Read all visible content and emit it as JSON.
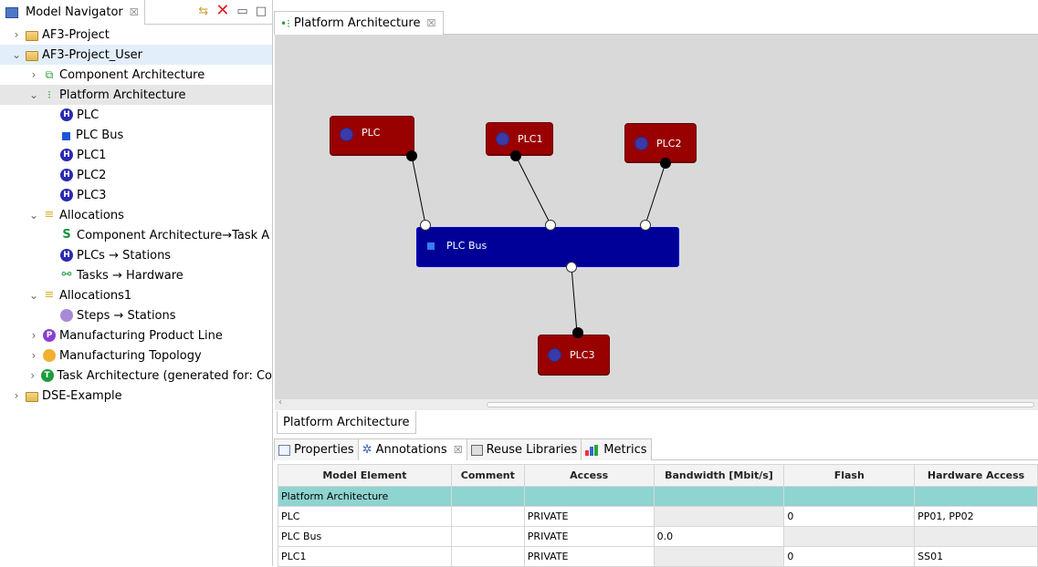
{
  "navigator": {
    "title": "Model Navigator",
    "close": "☒",
    "tree": [
      {
        "label": "AF3-Project",
        "level": 0,
        "twisty": "›",
        "icon": "folder"
      },
      {
        "label": "AF3-Project_User",
        "level": 0,
        "twisty": "⌄",
        "icon": "folder",
        "highlight": true
      },
      {
        "label": "Component Architecture",
        "level": 1,
        "twisty": "›",
        "icon": "component"
      },
      {
        "label": "Platform Architecture",
        "level": 1,
        "twisty": "⌄",
        "icon": "platform",
        "selected": true
      },
      {
        "label": "PLC",
        "level": 2,
        "icon": "h"
      },
      {
        "label": "PLC Bus",
        "level": 2,
        "icon": "bus"
      },
      {
        "label": "PLC1",
        "level": 2,
        "icon": "h"
      },
      {
        "label": "PLC2",
        "level": 2,
        "icon": "h"
      },
      {
        "label": "PLC3",
        "level": 2,
        "icon": "h"
      },
      {
        "label": "Allocations",
        "level": 1,
        "twisty": "⌄",
        "icon": "alloc"
      },
      {
        "label": "Component Architecture→Task A",
        "level": 2,
        "icon": "green-s"
      },
      {
        "label": "PLCs → Stations",
        "level": 2,
        "icon": "h"
      },
      {
        "label": "Tasks → Hardware",
        "level": 2,
        "icon": "task-hw"
      },
      {
        "label": "Allocations1",
        "level": 1,
        "twisty": "⌄",
        "icon": "alloc"
      },
      {
        "label": "Steps → Stations",
        "level": 2,
        "icon": "s"
      },
      {
        "label": "Manufacturing Product Line",
        "level": 1,
        "twisty": "›",
        "icon": "p"
      },
      {
        "label": "Manufacturing Topology",
        "level": 1,
        "twisty": "›",
        "icon": "o"
      },
      {
        "label": "Task Architecture (generated for: Co",
        "level": 1,
        "twisty": "›",
        "icon": "t"
      },
      {
        "label": "DSE-Example",
        "level": 0,
        "twisty": "›",
        "icon": "folder"
      }
    ]
  },
  "editor": {
    "tab_title": "Platform Architecture",
    "close": "☒",
    "bottom_tab": "Platform Architecture",
    "nodes": [
      {
        "label": "PLC"
      },
      {
        "label": "PLC1"
      },
      {
        "label": "PLC2"
      },
      {
        "label": "PLC3"
      }
    ],
    "bus": {
      "label": "PLC Bus"
    }
  },
  "bottom": {
    "tabs": [
      {
        "label": "Properties"
      },
      {
        "label": "Annotations",
        "close": "☒"
      },
      {
        "label": "Reuse Libraries"
      },
      {
        "label": "Metrics"
      }
    ],
    "table": {
      "headers": [
        "Model Element",
        "Comment",
        "Access",
        "Bandwidth [Mbit/s]",
        "Flash",
        "Hardware Access"
      ],
      "group": "Platform Architecture",
      "rows": [
        [
          "PLC",
          "",
          "PRIVATE",
          "",
          "0",
          "PP01, PP02"
        ],
        [
          "PLC Bus",
          "",
          "PRIVATE",
          "0.0",
          "",
          ""
        ],
        [
          "PLC1",
          "",
          "PRIVATE",
          "",
          "0",
          "SS01"
        ]
      ]
    }
  },
  "colors": {
    "node": "#990000",
    "bus": "#000099",
    "canvas": "#d9d9d9",
    "group_row": "#8ed4d0"
  }
}
